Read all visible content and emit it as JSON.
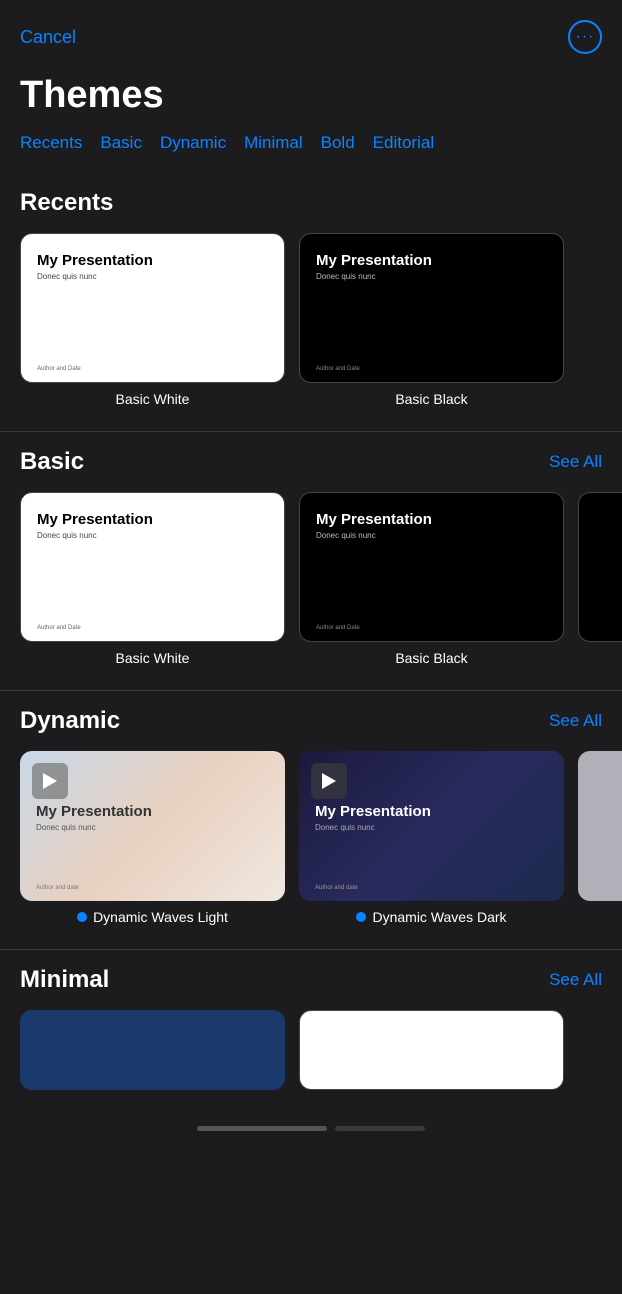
{
  "header": {
    "cancel_label": "Cancel",
    "more_icon": "···"
  },
  "page": {
    "title": "Themes"
  },
  "category_tabs": [
    {
      "label": "Recents",
      "id": "recents"
    },
    {
      "label": "Basic",
      "id": "basic"
    },
    {
      "label": "Dynamic",
      "id": "dynamic"
    },
    {
      "label": "Minimal",
      "id": "minimal"
    },
    {
      "label": "Bold",
      "id": "bold"
    },
    {
      "label": "Editorial",
      "id": "editorial"
    }
  ],
  "sections": {
    "recents": {
      "title": "Recents",
      "see_all": null,
      "themes": [
        {
          "name": "Basic White",
          "style": "white-theme",
          "preview_title": "My Presentation",
          "preview_subtitle": "Donec quis nunc",
          "preview_footer": "Author and Date",
          "has_play": false
        },
        {
          "name": "Basic Black",
          "style": "black-theme",
          "preview_title": "My Presentation",
          "preview_subtitle": "Donec quis nunc",
          "preview_footer": "Author and Date",
          "has_play": false
        }
      ]
    },
    "basic": {
      "title": "Basic",
      "see_all": "See All",
      "themes": [
        {
          "name": "Basic White",
          "style": "white-theme",
          "preview_title": "My Presentation",
          "preview_subtitle": "Donec quis nunc",
          "preview_footer": "Author and Date",
          "has_play": false
        },
        {
          "name": "Basic Black",
          "style": "black-theme",
          "preview_title": "My Presentation",
          "preview_subtitle": "Donec quis nunc",
          "preview_footer": "Author and Date",
          "has_play": false
        }
      ]
    },
    "dynamic": {
      "title": "Dynamic",
      "see_all": "See All",
      "themes": [
        {
          "name": "Dynamic Waves Light",
          "style": "waves-light",
          "preview_title": "My Presentation",
          "preview_subtitle": "Donec quis nunc",
          "preview_footer": "Author and date",
          "has_play": true
        },
        {
          "name": "Dynamic Waves Dark",
          "style": "waves-dark",
          "preview_title": "My Presentation",
          "preview_subtitle": "Donec quis nunc",
          "preview_footer": "Author and date",
          "has_play": true
        }
      ]
    },
    "minimal": {
      "title": "Minimal",
      "see_all": "See All"
    }
  },
  "bottom_indicator": {
    "active_label": "active",
    "inactive_label": "inactive"
  }
}
